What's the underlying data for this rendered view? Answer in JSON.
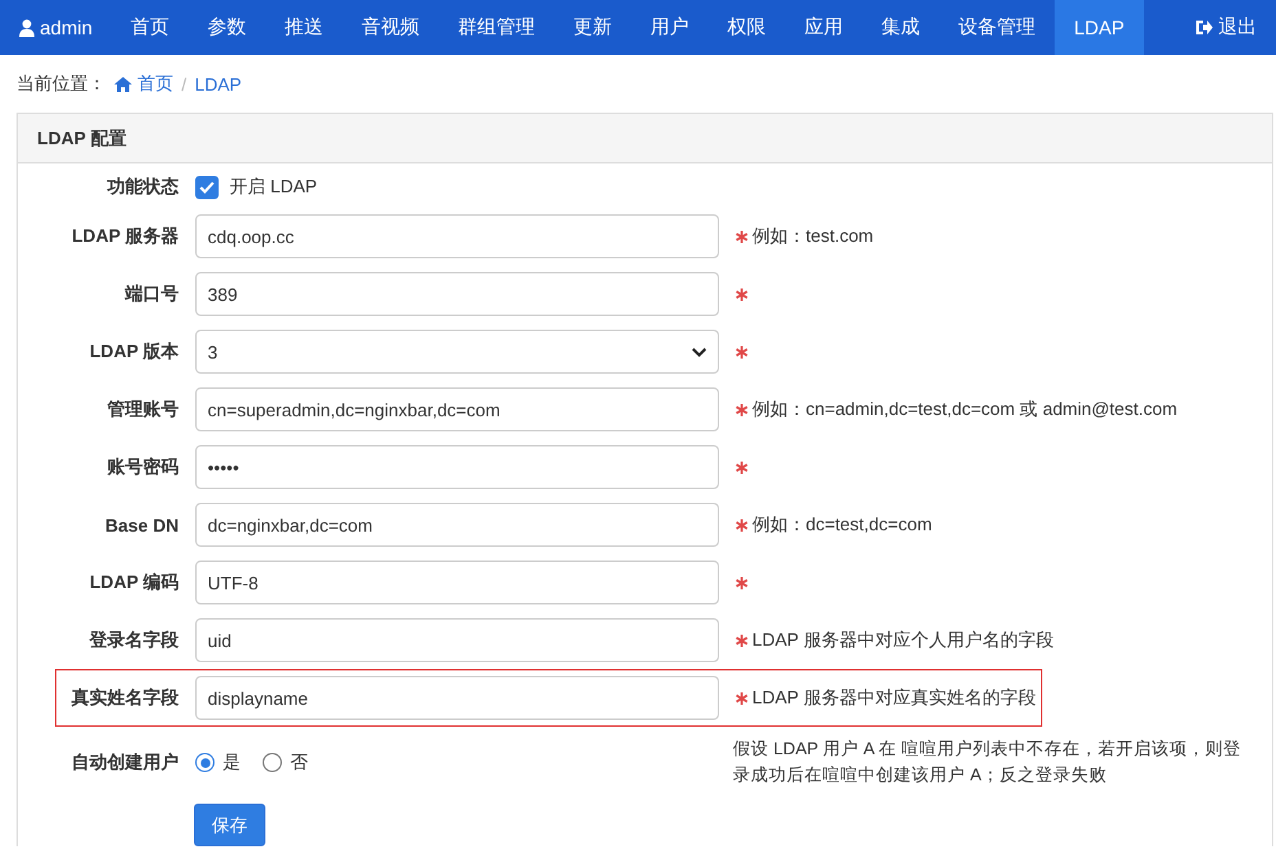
{
  "navbar": {
    "user": "admin",
    "items": [
      {
        "label": "首页",
        "selected": false
      },
      {
        "label": "参数",
        "selected": false
      },
      {
        "label": "推送",
        "selected": false
      },
      {
        "label": "音视频",
        "selected": false
      },
      {
        "label": "群组管理",
        "selected": false
      },
      {
        "label": "更新",
        "selected": false
      },
      {
        "label": "用户",
        "selected": false
      },
      {
        "label": "权限",
        "selected": false
      },
      {
        "label": "应用",
        "selected": false
      },
      {
        "label": "集成",
        "selected": false
      },
      {
        "label": "设备管理",
        "selected": false
      },
      {
        "label": "LDAP",
        "selected": true
      }
    ],
    "logout": "退出"
  },
  "breadcrumb": {
    "prefix": "当前位置：",
    "separator": "/",
    "items": [
      "首页",
      "LDAP"
    ]
  },
  "panel": {
    "title": "LDAP 配置",
    "fields": [
      {
        "kind": "checkbox",
        "label": "功能状态",
        "checked": true,
        "text": "开启 LDAP"
      },
      {
        "kind": "text",
        "label": "LDAP 服务器",
        "value": "cdq.oop.cc",
        "required": true,
        "hint": "例如：test.com"
      },
      {
        "kind": "text",
        "label": "端口号",
        "value": "389",
        "required": true
      },
      {
        "kind": "select",
        "label": "LDAP 版本",
        "value": "3",
        "required": true
      },
      {
        "kind": "text",
        "label": "管理账号",
        "value": "cn=superadmin,dc=nginxbar,dc=com",
        "required": true,
        "hint": "例如：cn=admin,dc=test,dc=com 或 admin@test.com"
      },
      {
        "kind": "text",
        "label": "账号密码",
        "value": "•••••",
        "required": true
      },
      {
        "kind": "text",
        "label": "Base DN",
        "value": "dc=nginxbar,dc=com",
        "required": true,
        "hint": "例如：dc=test,dc=com"
      },
      {
        "kind": "text",
        "label": "LDAP 编码",
        "value": "UTF-8",
        "required": true
      },
      {
        "kind": "text",
        "label": "登录名字段",
        "value": "uid",
        "required": true,
        "hint": "LDAP 服务器中对应个人用户名的字段"
      },
      {
        "kind": "text",
        "label": "真实姓名字段",
        "value": "displayname",
        "required": true,
        "hint": "LDAP 服务器中对应真实姓名的字段",
        "highlighted": true
      },
      {
        "kind": "radio",
        "label": "自动创建用户",
        "options": [
          {
            "label": "是",
            "selected": true
          },
          {
            "label": "否",
            "selected": false
          }
        ],
        "hint": "假设 LDAP 用户 A 在 喧喧用户列表中不存在，若开启该项，则登录成功后在喧喧中创建该用户 A；反之登录失败"
      }
    ],
    "save": "保存"
  }
}
